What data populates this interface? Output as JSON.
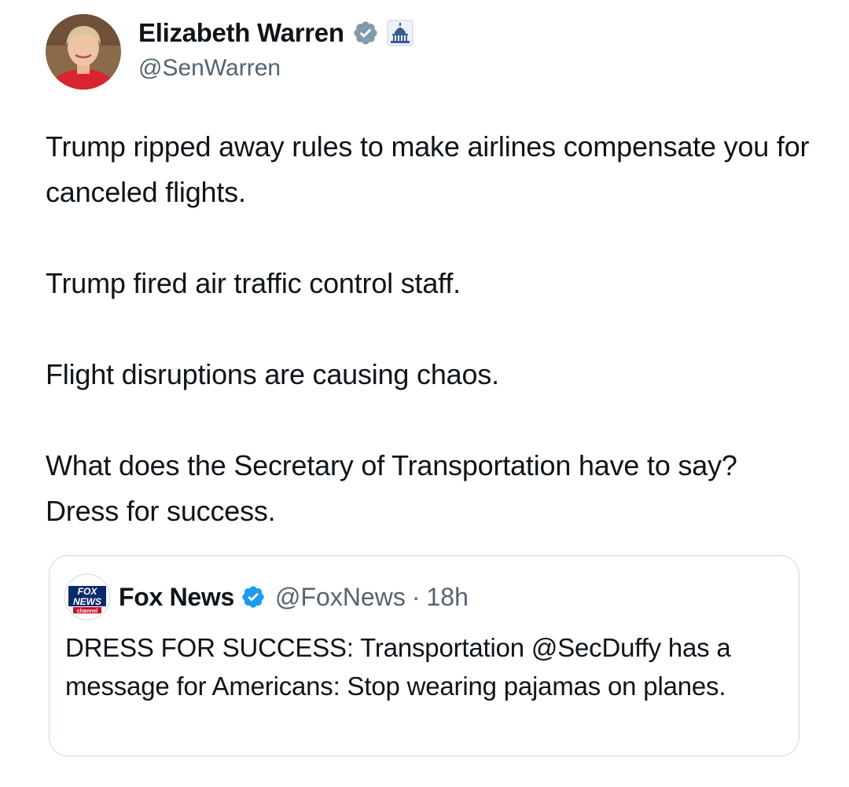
{
  "tweet": {
    "author": {
      "name": "Elizabeth Warren",
      "handle": "@SenWarren",
      "avatar_icon": "profile-photo",
      "verified_icon": "verified-badge-gray",
      "affiliation_icon": "us-capitol-government-badge"
    },
    "body": [
      "Trump ripped away rules to make airlines compensate you for canceled flights.",
      "Trump fired air traffic control staff.",
      "Flight disruptions are causing chaos.",
      "What does the Secretary of Transportation have to say? Dress for success."
    ],
    "quoted": {
      "name": "Fox News",
      "handle": "@FoxNews",
      "separator": "·",
      "time": "18h",
      "avatar_icon": "fox-news-logo",
      "verified_icon": "verified-badge-blue",
      "logo_text": [
        "FOX",
        "NEWS",
        "channel"
      ],
      "text": "DRESS FOR SUCCESS: Transportation @SecDuffy has a message for Americans: Stop wearing pajamas on planes."
    }
  },
  "colors": {
    "text_primary": "#0f1419",
    "text_secondary": "#536471",
    "border": "#cfd9de",
    "verified_gray": "#829aab",
    "verified_blue": "#1d9bf0",
    "gov_badge_blue": "#3b5998"
  }
}
